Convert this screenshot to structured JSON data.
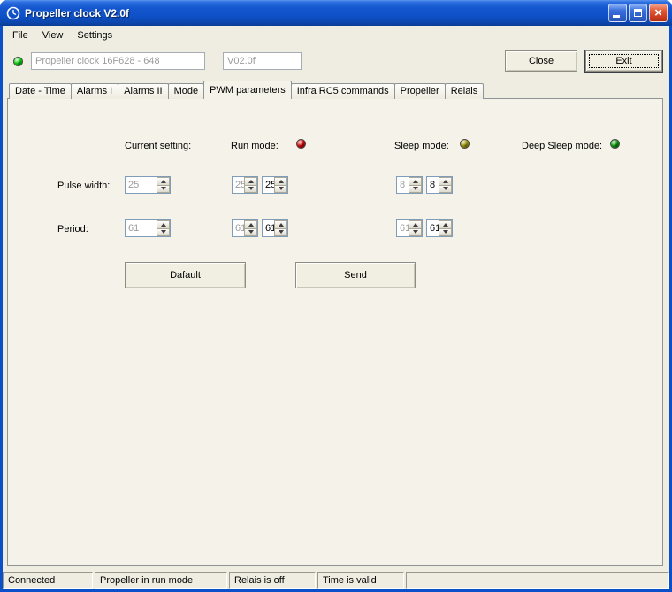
{
  "window": {
    "title": "Propeller clock V2.0f"
  },
  "menu": {
    "items": [
      "File",
      "View",
      "Settings"
    ]
  },
  "toolbar": {
    "connection_led_color": "#00DD00",
    "device_field_value": "Propeller clock 16F628 - 648",
    "version_field_value": "V02.0f",
    "close_button": "Close",
    "exit_button": "Exit"
  },
  "tabs": {
    "items": [
      "Date - Time",
      "Alarms I",
      "Alarms II",
      "Mode",
      "PWM parameters",
      "Infra RC5 commands",
      "Propeller",
      "Relais"
    ],
    "active": "PWM parameters"
  },
  "pwm": {
    "headers": {
      "current": "Current setting:",
      "run": "Run mode:",
      "run_led_color": "#E00000",
      "sleep": "Sleep mode:",
      "sleep_led_color": "#A8A000",
      "deep_sleep": "Deep Sleep mode:",
      "deep_sleep_led_color": "#00A400"
    },
    "rows": [
      {
        "label": "Pulse width:",
        "current": "25",
        "run": [
          "25",
          "25"
        ],
        "sleep": [
          "8",
          "8"
        ]
      },
      {
        "label": "Period:",
        "current": "61",
        "run": [
          "61",
          "61"
        ],
        "sleep": [
          "61",
          "61"
        ]
      }
    ],
    "buttons": {
      "default": "Dafault",
      "send": "Send"
    }
  },
  "statusbar": {
    "items": [
      "Connected",
      "Propeller in run mode",
      "Relais is off",
      "Time is valid"
    ]
  }
}
